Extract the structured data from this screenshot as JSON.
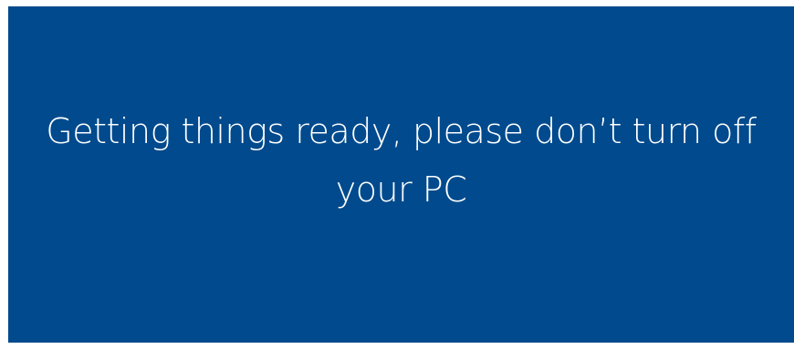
{
  "colors": {
    "background": "#004a8d",
    "text": "#ffffff"
  },
  "message": {
    "line1": "Getting things ready, please don’t turn off",
    "line2": "your PC"
  }
}
